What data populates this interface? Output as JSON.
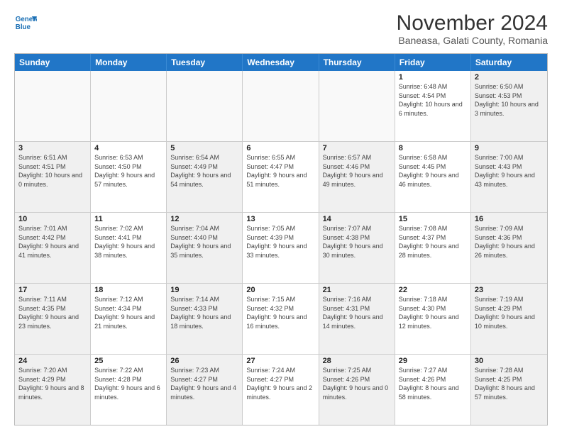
{
  "logo": {
    "line1": "General",
    "line2": "Blue"
  },
  "title": "November 2024",
  "subtitle": "Baneasa, Galati County, Romania",
  "header_days": [
    "Sunday",
    "Monday",
    "Tuesday",
    "Wednesday",
    "Thursday",
    "Friday",
    "Saturday"
  ],
  "weeks": [
    [
      {
        "day": "",
        "info": ""
      },
      {
        "day": "",
        "info": ""
      },
      {
        "day": "",
        "info": ""
      },
      {
        "day": "",
        "info": ""
      },
      {
        "day": "",
        "info": ""
      },
      {
        "day": "1",
        "info": "Sunrise: 6:48 AM\nSunset: 4:54 PM\nDaylight: 10 hours and 6 minutes."
      },
      {
        "day": "2",
        "info": "Sunrise: 6:50 AM\nSunset: 4:53 PM\nDaylight: 10 hours and 3 minutes."
      }
    ],
    [
      {
        "day": "3",
        "info": "Sunrise: 6:51 AM\nSunset: 4:51 PM\nDaylight: 10 hours and 0 minutes."
      },
      {
        "day": "4",
        "info": "Sunrise: 6:53 AM\nSunset: 4:50 PM\nDaylight: 9 hours and 57 minutes."
      },
      {
        "day": "5",
        "info": "Sunrise: 6:54 AM\nSunset: 4:49 PM\nDaylight: 9 hours and 54 minutes."
      },
      {
        "day": "6",
        "info": "Sunrise: 6:55 AM\nSunset: 4:47 PM\nDaylight: 9 hours and 51 minutes."
      },
      {
        "day": "7",
        "info": "Sunrise: 6:57 AM\nSunset: 4:46 PM\nDaylight: 9 hours and 49 minutes."
      },
      {
        "day": "8",
        "info": "Sunrise: 6:58 AM\nSunset: 4:45 PM\nDaylight: 9 hours and 46 minutes."
      },
      {
        "day": "9",
        "info": "Sunrise: 7:00 AM\nSunset: 4:43 PM\nDaylight: 9 hours and 43 minutes."
      }
    ],
    [
      {
        "day": "10",
        "info": "Sunrise: 7:01 AM\nSunset: 4:42 PM\nDaylight: 9 hours and 41 minutes."
      },
      {
        "day": "11",
        "info": "Sunrise: 7:02 AM\nSunset: 4:41 PM\nDaylight: 9 hours and 38 minutes."
      },
      {
        "day": "12",
        "info": "Sunrise: 7:04 AM\nSunset: 4:40 PM\nDaylight: 9 hours and 35 minutes."
      },
      {
        "day": "13",
        "info": "Sunrise: 7:05 AM\nSunset: 4:39 PM\nDaylight: 9 hours and 33 minutes."
      },
      {
        "day": "14",
        "info": "Sunrise: 7:07 AM\nSunset: 4:38 PM\nDaylight: 9 hours and 30 minutes."
      },
      {
        "day": "15",
        "info": "Sunrise: 7:08 AM\nSunset: 4:37 PM\nDaylight: 9 hours and 28 minutes."
      },
      {
        "day": "16",
        "info": "Sunrise: 7:09 AM\nSunset: 4:36 PM\nDaylight: 9 hours and 26 minutes."
      }
    ],
    [
      {
        "day": "17",
        "info": "Sunrise: 7:11 AM\nSunset: 4:35 PM\nDaylight: 9 hours and 23 minutes."
      },
      {
        "day": "18",
        "info": "Sunrise: 7:12 AM\nSunset: 4:34 PM\nDaylight: 9 hours and 21 minutes."
      },
      {
        "day": "19",
        "info": "Sunrise: 7:14 AM\nSunset: 4:33 PM\nDaylight: 9 hours and 18 minutes."
      },
      {
        "day": "20",
        "info": "Sunrise: 7:15 AM\nSunset: 4:32 PM\nDaylight: 9 hours and 16 minutes."
      },
      {
        "day": "21",
        "info": "Sunrise: 7:16 AM\nSunset: 4:31 PM\nDaylight: 9 hours and 14 minutes."
      },
      {
        "day": "22",
        "info": "Sunrise: 7:18 AM\nSunset: 4:30 PM\nDaylight: 9 hours and 12 minutes."
      },
      {
        "day": "23",
        "info": "Sunrise: 7:19 AM\nSunset: 4:29 PM\nDaylight: 9 hours and 10 minutes."
      }
    ],
    [
      {
        "day": "24",
        "info": "Sunrise: 7:20 AM\nSunset: 4:29 PM\nDaylight: 9 hours and 8 minutes."
      },
      {
        "day": "25",
        "info": "Sunrise: 7:22 AM\nSunset: 4:28 PM\nDaylight: 9 hours and 6 minutes."
      },
      {
        "day": "26",
        "info": "Sunrise: 7:23 AM\nSunset: 4:27 PM\nDaylight: 9 hours and 4 minutes."
      },
      {
        "day": "27",
        "info": "Sunrise: 7:24 AM\nSunset: 4:27 PM\nDaylight: 9 hours and 2 minutes."
      },
      {
        "day": "28",
        "info": "Sunrise: 7:25 AM\nSunset: 4:26 PM\nDaylight: 9 hours and 0 minutes."
      },
      {
        "day": "29",
        "info": "Sunrise: 7:27 AM\nSunset: 4:26 PM\nDaylight: 8 hours and 58 minutes."
      },
      {
        "day": "30",
        "info": "Sunrise: 7:28 AM\nSunset: 4:25 PM\nDaylight: 8 hours and 57 minutes."
      }
    ]
  ]
}
